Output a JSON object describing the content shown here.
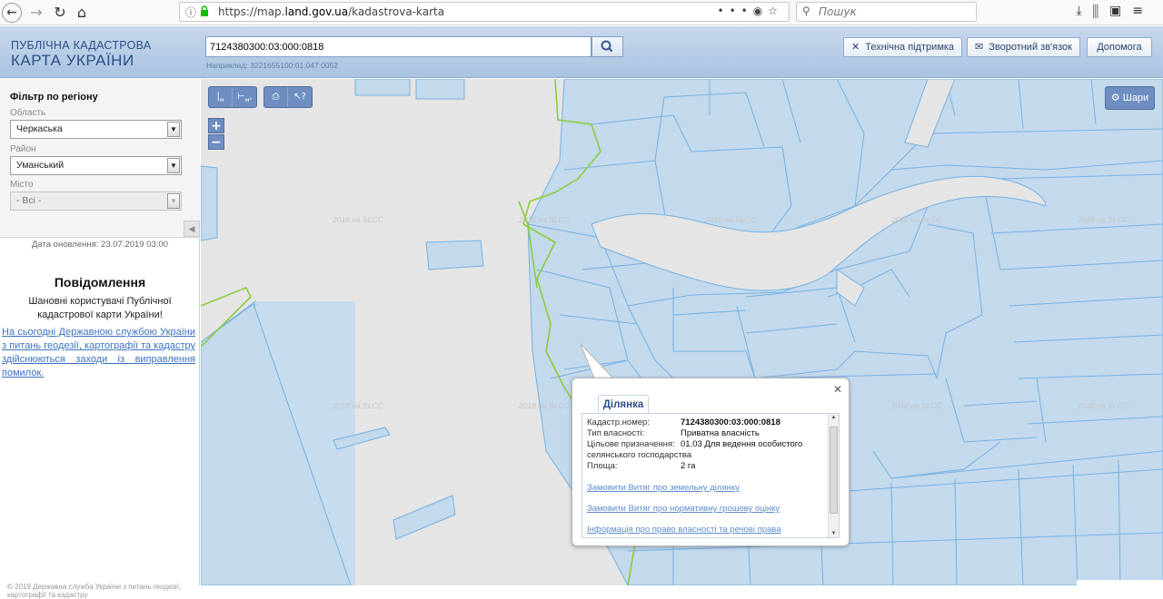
{
  "browser": {
    "url_prefix": "https://map.",
    "url_domain": "land.gov.ua",
    "url_suffix": "/kadastrova-karta",
    "search_placeholder": "Пошук"
  },
  "header": {
    "logo_line1": "ПУБЛІЧНА КАДАСТРОВА",
    "logo_line2": "КАРТА УКРАЇНИ",
    "cadastral_value": "7124380300:03:000:0818",
    "example_text": "Наприклад: 3221655100:01:047:0052",
    "support_label": "Технічна підтримка",
    "feedback_label": "Зворотний зв'язок",
    "help_label": "Допомога"
  },
  "sidebar": {
    "filter_title": "Фільтр по регіону",
    "region_label": "Область",
    "region_value": "Черкаська",
    "district_label": "Район",
    "district_value": "Уманський",
    "city_label": "Місто",
    "city_value": "- Всі -",
    "updated": "Дата оновлення: 23.07.2019 03:00",
    "notice_title": "Повідомлення",
    "notice_text": "Шановні користувачі Публічної кадастрової карти України!",
    "notice_link": "На сьогодні Державною службою України з питань геодезії, картографії та кадастру здійснюються заходи із виправлення помилок.",
    "footer": "© 2019 Державна служба України з питань геодезії, картографії та кадастру"
  },
  "map": {
    "layers_label": "Шари",
    "zoom_in": "+",
    "zoom_out": "−",
    "watermark": "2018 на SLCC"
  },
  "popup": {
    "tab": "Ділянка",
    "fields": [
      {
        "key": "Кадастр.номер:",
        "value": "7124380300:03:000:0818"
      },
      {
        "key": "Тип власності:",
        "value": "Приватна власність"
      },
      {
        "key": "Цільове призначення:",
        "value": "01.03 Для ведення особистого"
      },
      {
        "key": "",
        "value": "селянського господарства"
      },
      {
        "key": "Площа:",
        "value": "2 га"
      }
    ],
    "link1": "Замовити Витяг про земельну ділянку",
    "link2": "Замовити Витяг про нормативну грошову оцінку",
    "link3": "Інформація про право власності та речові права"
  }
}
